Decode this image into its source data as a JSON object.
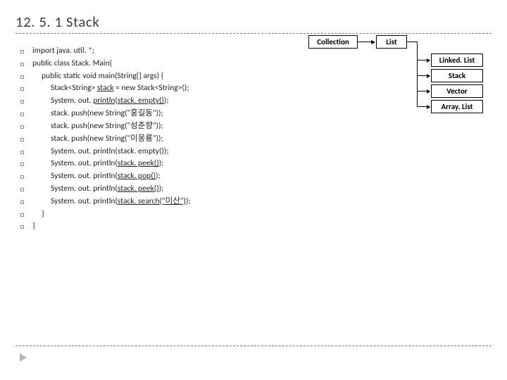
{
  "title": "12. 5. 1 Stack",
  "code": {
    "l0": "import java. util. *;",
    "l1": "public class Stack. Main{",
    "l2": "     public static void main(String[] args) {",
    "l3a": "          Stack<String> ",
    "l3b": "stack",
    "l3c": " = new Stack<String>();",
    "l4a": "          System. out. ",
    "l4b": "println",
    "l4c": "(",
    "l4d": "stack. empty()",
    "l4e": ");",
    "l5": "          stack. push(new String(\"홍길동\"));",
    "l6": "          stack. push(new String(\"성춘향\"));",
    "l7": "          stack. push(new String(\"이몽룡\"));",
    "l8": "          System. out. println(stack. empty());",
    "l9a": "          System. out. println(",
    "l9b": "stack. peek()",
    "l9c": ");",
    "l10a": "          System. out. println(",
    "l10b": "stack. pop()",
    "l10c": ");",
    "l11a": "          System. out. println(",
    "l11b": "stack. peek()",
    "l11c": ");",
    "l12a": "          System. out. println(",
    "l12b": "stack. search(\"이산\")",
    "l12c": ");",
    "l13": "     }",
    "l14": "}"
  },
  "diagram": {
    "collection": "Collection",
    "list": "List",
    "linked": "Linked. List",
    "stack": "Stack",
    "vector": "Vector",
    "arraylist": "Array. List"
  }
}
